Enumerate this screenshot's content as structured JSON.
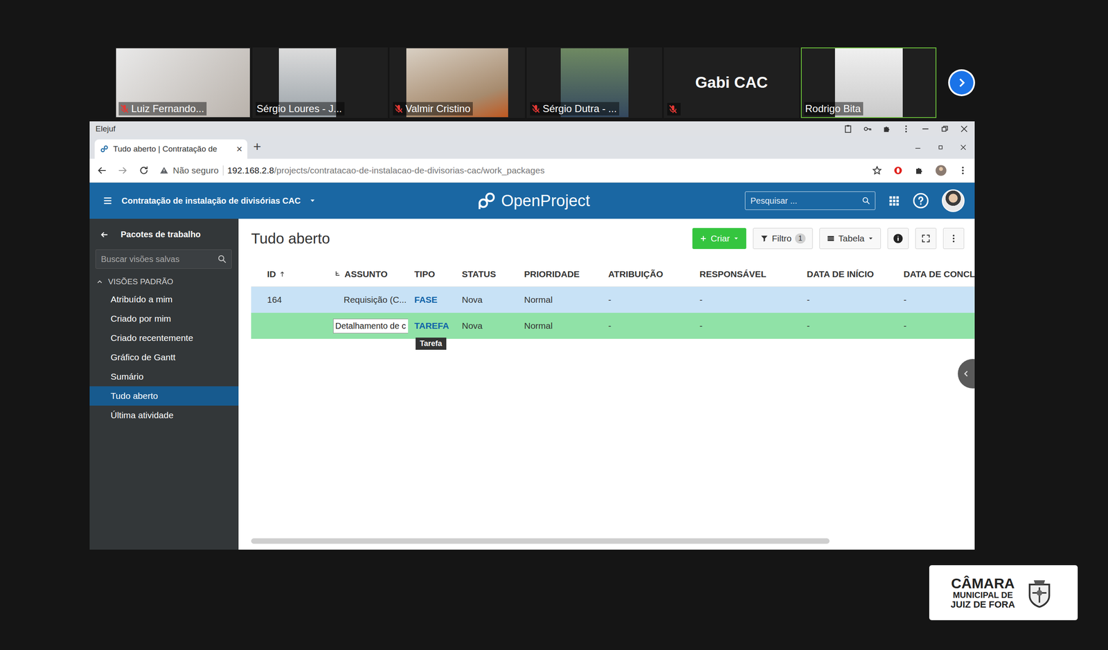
{
  "call": {
    "participants": [
      {
        "name": "Luiz Fernando...",
        "muted": true,
        "kind": "video-full",
        "active": false
      },
      {
        "name": "Sérgio Loures - J...",
        "muted": false,
        "kind": "video-narrow",
        "active": false
      },
      {
        "name": "Valmir Cristino",
        "muted": true,
        "kind": "video",
        "active": false
      },
      {
        "name": "Sérgio Dutra - ...",
        "muted": true,
        "kind": "video-narrow",
        "active": false
      },
      {
        "name": "Gabi CAC",
        "muted": true,
        "kind": "avatar",
        "active": false
      },
      {
        "name": "Rodrigo Bita",
        "muted": false,
        "kind": "video-narrow",
        "active": true
      }
    ]
  },
  "browser": {
    "window_title": "Elejuf",
    "tab": {
      "title": "Tudo aberto | Contratação de",
      "close": "×"
    },
    "new_tab": "+",
    "address": {
      "security": "Não seguro",
      "host": "192.168.2.8",
      "path": "/projects/contratacao-de-instalacao-de-divisorias-cac/work_packages"
    }
  },
  "header": {
    "project": "Contratação de instalação de divisórias CAC",
    "logo": "OpenProject",
    "search_placeholder": "Pesquisar ..."
  },
  "sidebar": {
    "back_title": "Pacotes de trabalho",
    "search_placeholder": "Buscar visões salvas",
    "section": {
      "label": "VISÕES PADRÃO",
      "expanded": true
    },
    "items": [
      {
        "label": "Atribuído a mim",
        "selected": false
      },
      {
        "label": "Criado por mim",
        "selected": false
      },
      {
        "label": "Criado recentemente",
        "selected": false
      },
      {
        "label": "Gráfico de Gantt",
        "selected": false
      },
      {
        "label": "Sumário",
        "selected": false
      },
      {
        "label": "Tudo aberto",
        "selected": true
      },
      {
        "label": "Última atividade",
        "selected": false
      }
    ]
  },
  "toolbar": {
    "title": "Tudo aberto",
    "create": "Criar",
    "filter": {
      "label": "Filtro",
      "count": "1"
    },
    "view": "Tabela"
  },
  "table": {
    "columns": [
      {
        "label": "ID",
        "sorted": true
      },
      {
        "label": "ASSUNTO",
        "sorted": false
      },
      {
        "label": "TIPO",
        "sorted": false
      },
      {
        "label": "STATUS",
        "sorted": false
      },
      {
        "label": "PRIORIDADE",
        "sorted": false
      },
      {
        "label": "ATRIBUIÇÃO",
        "sorted": false
      },
      {
        "label": "RESPONSÁVEL",
        "sorted": false
      },
      {
        "label": "DATA DE INÍCIO",
        "sorted": false
      },
      {
        "label": "DATA DE CONCL",
        "sorted": false
      }
    ],
    "rows": [
      {
        "kind": "existing",
        "selected": true,
        "cells": [
          "164",
          "Requisição (C...",
          "FASE",
          "Nova",
          "Normal",
          "-",
          "-",
          "-",
          "-"
        ]
      },
      {
        "kind": "new",
        "selected": false,
        "cells": [
          "",
          "Detalhamento de c",
          "TAREFA",
          "Nova",
          "Normal",
          "-",
          "-",
          "-",
          "-"
        ]
      }
    ],
    "tooltip": "Tarefa"
  },
  "branding": {
    "lines": [
      "CÂMARA",
      "MUNICIPAL DE",
      "JUIZ DE FORA"
    ]
  }
}
